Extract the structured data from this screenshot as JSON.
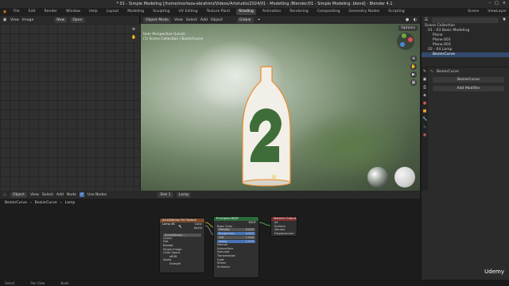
{
  "window": {
    "title": "* 01 - Simple Modeling [/home/morteza-ebrahimi/Videos/Artstudio/2024/01 - Modelling /Blender/01 - Simple Modeling .blend] - Blender 4.1"
  },
  "menu": [
    "File",
    "Edit",
    "Render",
    "Window",
    "Help"
  ],
  "workspaces": [
    "Layout",
    "Modeling",
    "Sculpting",
    "UV Editing",
    "Texture Paint",
    "Shading",
    "Animation",
    "Rendering",
    "Compositing",
    "Geometry Nodes",
    "Scripting"
  ],
  "active_workspace": "Shading",
  "scene": "Scene",
  "view_layer": "ViewLayer",
  "image_editor": {
    "menus": [
      "View",
      "Image"
    ],
    "new_label": "New",
    "open_label": "Open"
  },
  "viewport": {
    "mode": "Object Mode",
    "menus": [
      "View",
      "Select",
      "Add",
      "Object"
    ],
    "orientation": "Global",
    "overlay1": "User Perspective (Local)",
    "overlay2": "(1) Scene Collection | BezierCurve",
    "options": "Options"
  },
  "outliner": {
    "items": [
      "Scene Collection",
      "01 - 03 Basic Modeling",
      "Plane",
      "Plane.001",
      "Plane.003",
      "02 - 04 Lamp",
      "BezierCurve"
    ],
    "selected": 6
  },
  "properties": {
    "object": "BezierCurve",
    "add_modifier": "Add Modifier"
  },
  "node_editor": {
    "header": [
      "Object",
      "View",
      "Select",
      "Add",
      "Node",
      "Use Nodes"
    ],
    "slot": "Slot 1",
    "material": "Lamp",
    "breadcrumb": [
      "BezierCurve",
      "BezierCurve",
      "Lamp"
    ]
  },
  "nodes": {
    "texture": {
      "title": "Arrs&Wenau Pol Texture Lamp 4K",
      "rows": [
        "Color",
        "Alpha",
        "",
        "Arrs&Wenau...",
        "Linear",
        "Flat",
        "Repeat",
        "Single Image",
        "Color Space",
        "sRGB",
        "Alpha",
        "Straight",
        "Vector"
      ]
    },
    "bsdf": {
      "title": "Principled BSDF",
      "rows": [
        "BSDF",
        "Base Color",
        "Metallic",
        "Roughness",
        "IOR",
        "Alpha",
        "Normal",
        "Subsurface",
        "Specular",
        "Transmission",
        "Coat",
        "Sheen",
        "Emission"
      ],
      "values": [
        "0.000",
        "0.500",
        "1.450",
        "1.000"
      ]
    },
    "output": {
      "title": "Material Output",
      "rows": [
        "All",
        "Surface",
        "Volume",
        "Displacement"
      ]
    }
  },
  "status": [
    "Select",
    "Pan View",
    "Node"
  ],
  "watermark": "Udemy"
}
